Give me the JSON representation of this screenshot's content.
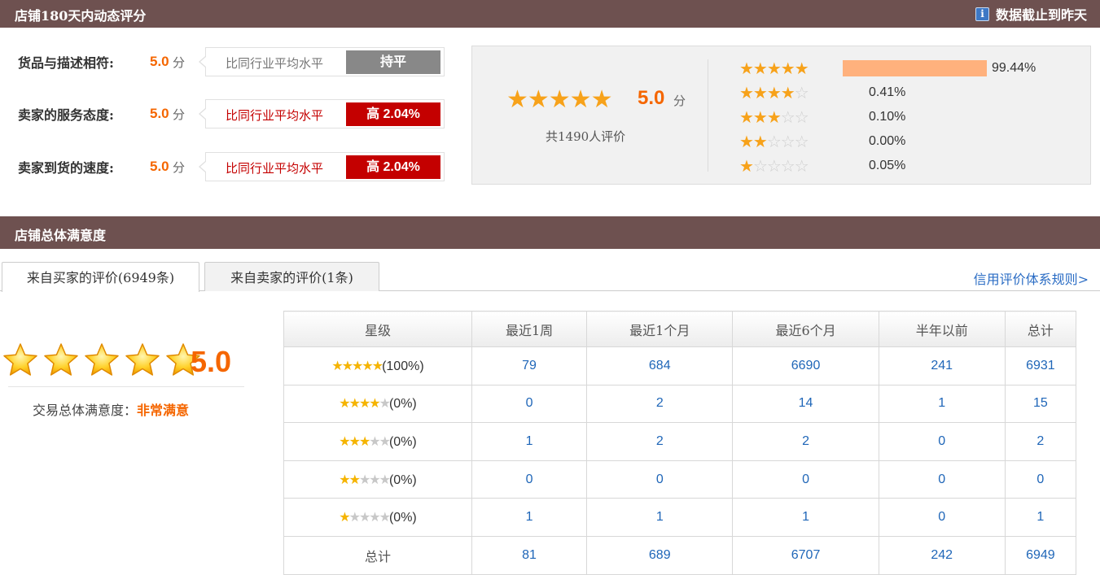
{
  "header": {
    "title": "店铺180天内动态评分",
    "data_note": "数据截止到昨天",
    "info_icon": "i"
  },
  "dsr": {
    "rows": [
      {
        "label": "货品与描述相符:",
        "score": "5.0",
        "unit": "分",
        "compare": "比同行业平均水平",
        "badge": "持平",
        "badge_color": "#888888",
        "compare_color": "#777777"
      },
      {
        "label": "卖家的服务态度:",
        "score": "5.0",
        "unit": "分",
        "compare": "比同行业平均水平",
        "badge": "高 2.04%",
        "badge_color": "#c40000",
        "compare_color": "#c40000"
      },
      {
        "label": "卖家到货的速度:",
        "score": "5.0",
        "unit": "分",
        "compare": "比同行业平均水平",
        "badge": "高 2.04%",
        "badge_color": "#c40000",
        "compare_color": "#c40000"
      }
    ]
  },
  "summary": {
    "stars": "★★★★★",
    "score": "5.0",
    "unit": "分",
    "count_text": "共1490人评价",
    "distribution": [
      {
        "stars": 5,
        "pct": "99.44%",
        "fraction": 0.9944
      },
      {
        "stars": 4,
        "pct": "0.41%",
        "fraction": 0.0041
      },
      {
        "stars": 3,
        "pct": "0.10%",
        "fraction": 0.001
      },
      {
        "stars": 2,
        "pct": "0.00%",
        "fraction": 0.0
      },
      {
        "stars": 1,
        "pct": "0.05%",
        "fraction": 0.0005
      }
    ]
  },
  "overall": {
    "section_title": "店铺总体满意度",
    "tabs": [
      "来自买家的评价(6949条)",
      "来自卖家的评价(1条)"
    ],
    "rules_link": "信用评价体系规则>",
    "score": "5.0",
    "satisfaction_label": "交易总体满意度：",
    "satisfaction_value": "非常满意"
  },
  "table": {
    "headers": [
      "星级",
      "最近1周",
      "最近1个月",
      "最近6个月",
      "半年以前",
      "总计"
    ],
    "rows": [
      {
        "stars": 5,
        "pct": "(100%)",
        "values": [
          "79",
          "684",
          "6690",
          "241",
          "6931"
        ]
      },
      {
        "stars": 4,
        "pct": "(0%)",
        "values": [
          "0",
          "2",
          "14",
          "1",
          "15"
        ]
      },
      {
        "stars": 3,
        "pct": "(0%)",
        "values": [
          "1",
          "2",
          "2",
          "0",
          "2"
        ]
      },
      {
        "stars": 2,
        "pct": "(0%)",
        "values": [
          "0",
          "0",
          "0",
          "0",
          "0"
        ]
      },
      {
        "stars": 1,
        "pct": "(0%)",
        "values": [
          "1",
          "1",
          "1",
          "0",
          "1"
        ]
      }
    ],
    "total_row": {
      "label": "总计",
      "values": [
        "81",
        "689",
        "6707",
        "242",
        "6949"
      ]
    }
  },
  "colors": {
    "brand_bar": "#6e5150",
    "accent": "#f56600",
    "link": "#2a6cc4",
    "bar_fill": "#ffb17d"
  }
}
